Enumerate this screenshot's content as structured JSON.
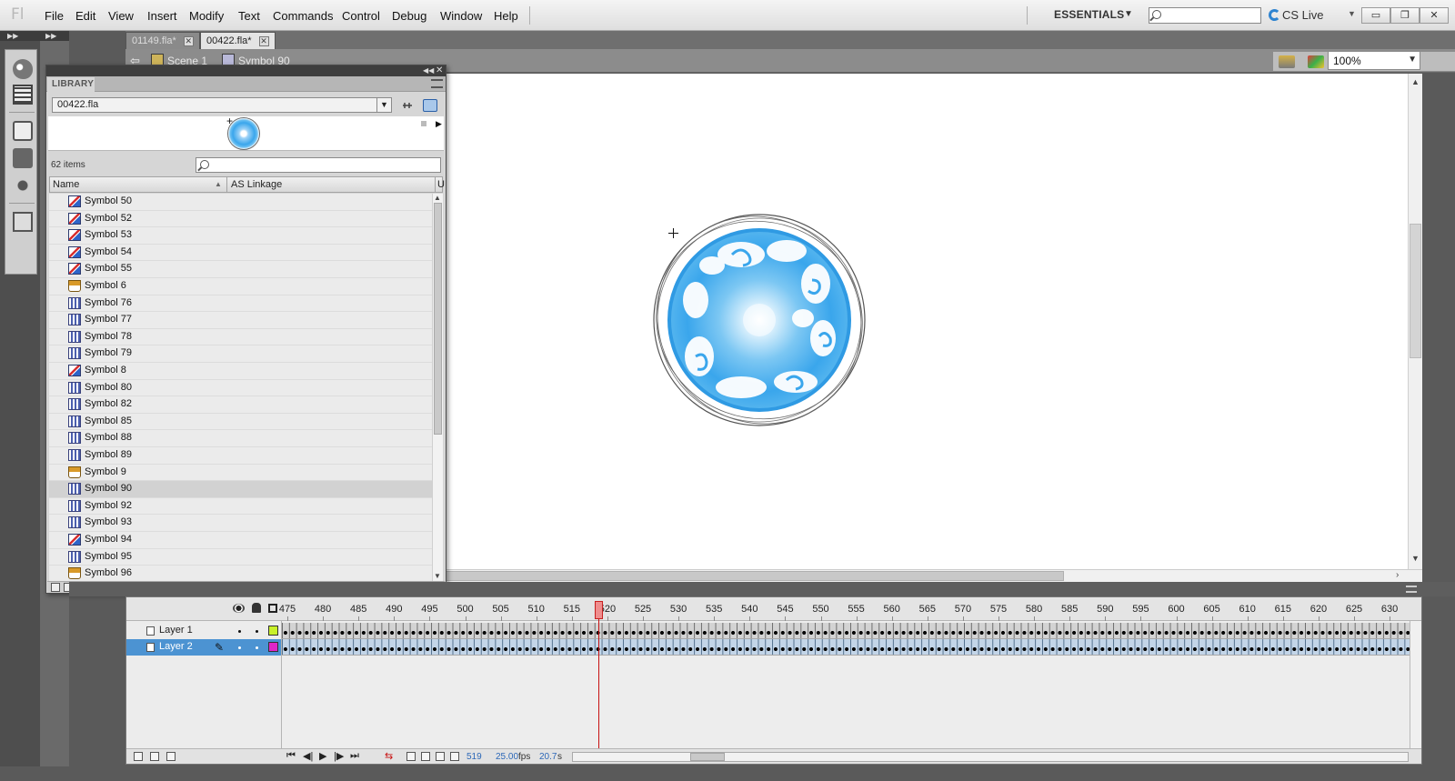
{
  "app": {
    "logo": "Fl"
  },
  "menu": [
    "File",
    "Edit",
    "View",
    "Insert",
    "Modify",
    "Text",
    "Commands",
    "Control",
    "Debug",
    "Window",
    "Help"
  ],
  "workspace": {
    "label": "ESSENTIALS",
    "caret": "▼"
  },
  "search": {
    "placeholder": ""
  },
  "cslive": {
    "label": "CS Live",
    "caret": "▼"
  },
  "window_buttons": {
    "minimize": "▭",
    "restore": "❐",
    "close": "✕"
  },
  "panel_collapse": "▶▶",
  "doc_tabs": [
    {
      "label": "01149.fla*",
      "close": "✕",
      "active": false
    },
    {
      "label": "00422.fla*",
      "close": "✕",
      "active": true
    }
  ],
  "breadcrumb": {
    "back": "⇦",
    "scene": "Scene 1",
    "symbol": "Symbol 90"
  },
  "zoom": {
    "value": "100%",
    "caret": "▼"
  },
  "library": {
    "tab_label": "LIBRARY",
    "file": "00422.fla",
    "file_caret": "▼",
    "collapse": "◀◀",
    "close": "✕",
    "preview_cross": "+",
    "preview_play": "▶",
    "count": "62 items",
    "columns": {
      "name": "Name",
      "sort": "▲",
      "linkage": "AS Linkage",
      "use": "U"
    },
    "scroll_up": "▲",
    "scroll_down": "▼",
    "items": [
      {
        "name": "Symbol 50",
        "type": "graphic"
      },
      {
        "name": "Symbol 52",
        "type": "graphic"
      },
      {
        "name": "Symbol 53",
        "type": "graphic"
      },
      {
        "name": "Symbol 54",
        "type": "graphic"
      },
      {
        "name": "Symbol 55",
        "type": "graphic"
      },
      {
        "name": "Symbol 6",
        "type": "button"
      },
      {
        "name": "Symbol 76",
        "type": "movie"
      },
      {
        "name": "Symbol 77",
        "type": "movie"
      },
      {
        "name": "Symbol 78",
        "type": "movie"
      },
      {
        "name": "Symbol 79",
        "type": "movie"
      },
      {
        "name": "Symbol 8",
        "type": "graphic"
      },
      {
        "name": "Symbol 80",
        "type": "movie"
      },
      {
        "name": "Symbol 82",
        "type": "movie"
      },
      {
        "name": "Symbol 85",
        "type": "movie"
      },
      {
        "name": "Symbol 88",
        "type": "movie"
      },
      {
        "name": "Symbol 89",
        "type": "movie"
      },
      {
        "name": "Symbol 9",
        "type": "button"
      },
      {
        "name": "Symbol 90",
        "type": "movie",
        "selected": true
      },
      {
        "name": "Symbol 92",
        "type": "movie"
      },
      {
        "name": "Symbol 93",
        "type": "movie"
      },
      {
        "name": "Symbol 94",
        "type": "graphic"
      },
      {
        "name": "Symbol 95",
        "type": "movie"
      },
      {
        "name": "Symbol 96",
        "type": "button"
      }
    ]
  },
  "timeline": {
    "ruler": [
      "475",
      "480",
      "485",
      "490",
      "495",
      "500",
      "505",
      "510",
      "515",
      "520",
      "525",
      "530",
      "535",
      "540",
      "545",
      "550",
      "555",
      "560",
      "565",
      "570",
      "575",
      "580",
      "585",
      "590",
      "595",
      "600",
      "605",
      "610",
      "615",
      "620",
      "625",
      "630"
    ],
    "layers": [
      {
        "name": "Layer 1",
        "color": "#c8f029",
        "selected": false
      },
      {
        "name": "Layer 2",
        "color": "#e026c8",
        "selected": true
      }
    ],
    "pencil": "✎",
    "controls": {
      "first": "⏮",
      "prev": "◀|",
      "play": "▶",
      "next": "|▶",
      "last": "⏭",
      "loop": "⇆"
    },
    "current_frame": "519",
    "fps": "25.00",
    "fps_unit": "fps",
    "elapsed": "20.7",
    "elapsed_unit": "s"
  },
  "colors": {
    "accent": "#4c93d2",
    "stage": "#ffffff",
    "chrome": "#5a5a5a",
    "orb_blue": "#3aa6ec"
  }
}
